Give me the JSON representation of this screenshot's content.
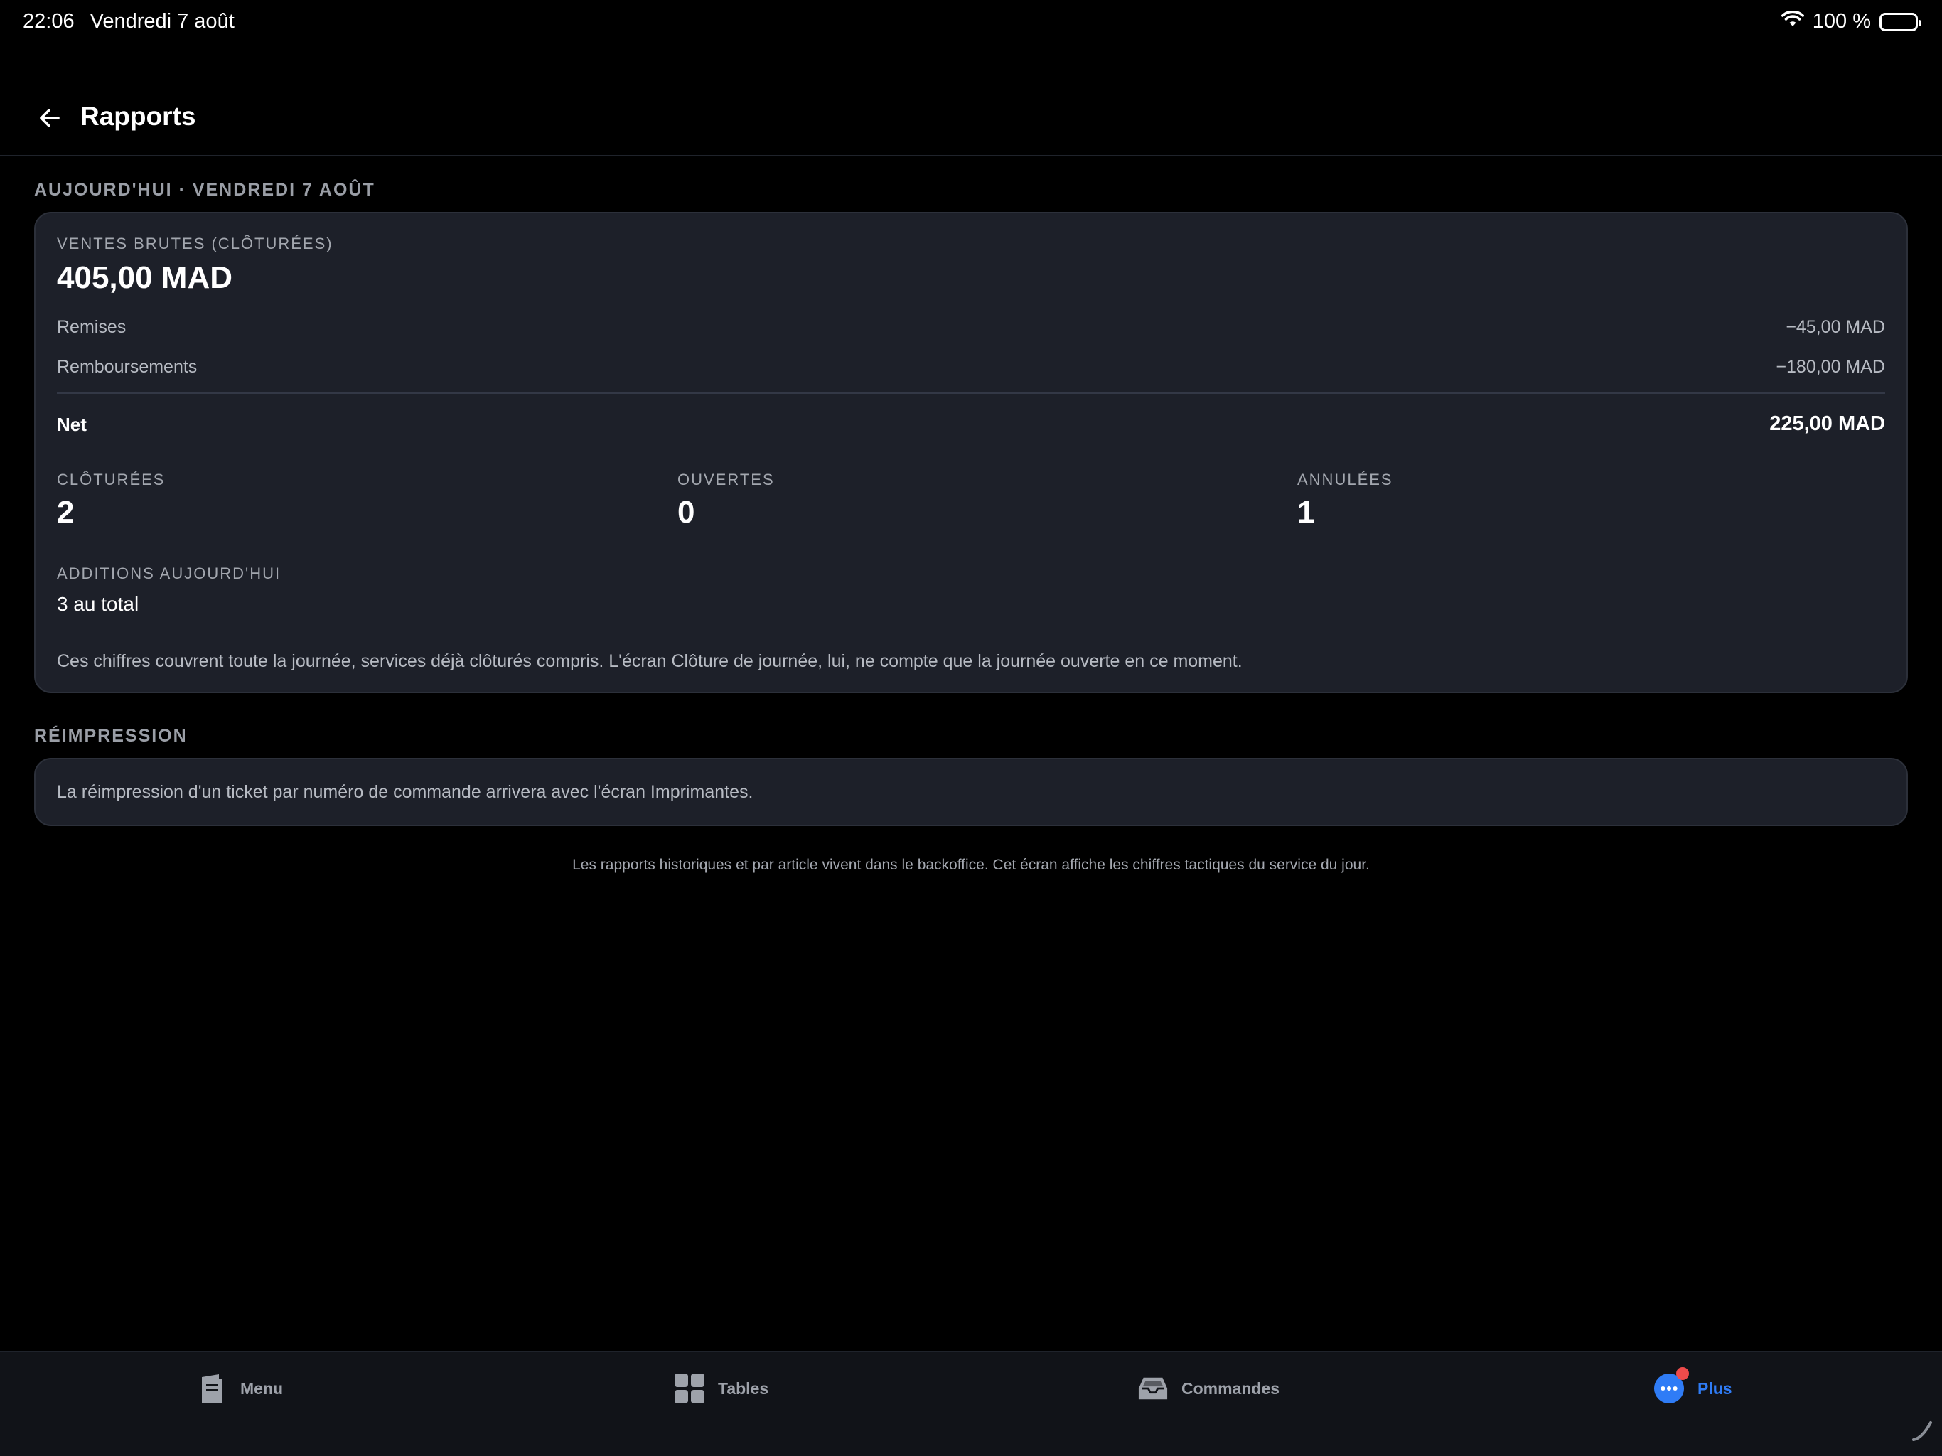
{
  "status_bar": {
    "time": "22:06",
    "date": "Vendredi 7 août",
    "battery": "100 %"
  },
  "header": {
    "title": "Rapports"
  },
  "today": {
    "section_label": "AUJOURD'HUI · VENDREDI 7 AOÛT",
    "gross_label": "VENTES BRUTES (CLÔTURÉES)",
    "gross_amount": "405,00 MAD",
    "discounts_label": "Remises",
    "discounts_value": "−45,00 MAD",
    "refunds_label": "Remboursements",
    "refunds_value": "−180,00 MAD",
    "net_label": "Net",
    "net_value": "225,00 MAD",
    "stats": [
      {
        "label": "CLÔTURÉES",
        "value": "2"
      },
      {
        "label": "OUVERTES",
        "value": "0"
      },
      {
        "label": "ANNULÉES",
        "value": "1"
      }
    ],
    "additions_label": "ADDITIONS AUJOURD'HUI",
    "additions_value": "3 au total",
    "note": "Ces chiffres couvrent toute la journée, services déjà clôturés compris. L'écran Clôture de journée, lui, ne compte que la journée ouverte en ce moment."
  },
  "reprint": {
    "section_label": "RÉIMPRESSION",
    "text": "La réimpression d'un ticket par numéro de commande arrivera avec l'écran Imprimantes."
  },
  "footer_note": "Les rapports historiques et par article vivent dans le backoffice. Cet écran affiche les chiffres tactiques du service du jour.",
  "tabs": [
    {
      "label": "Menu",
      "icon": "menu-book-icon"
    },
    {
      "label": "Tables",
      "icon": "tables-grid-icon"
    },
    {
      "label": "Commandes",
      "icon": "orders-tray-icon"
    },
    {
      "label": "Plus",
      "icon": "more-dots-icon",
      "active": true
    }
  ],
  "colors": {
    "background": "#000000",
    "card": "#1d2029",
    "accent": "#2f7cf6",
    "badge": "#ef4b4b"
  }
}
